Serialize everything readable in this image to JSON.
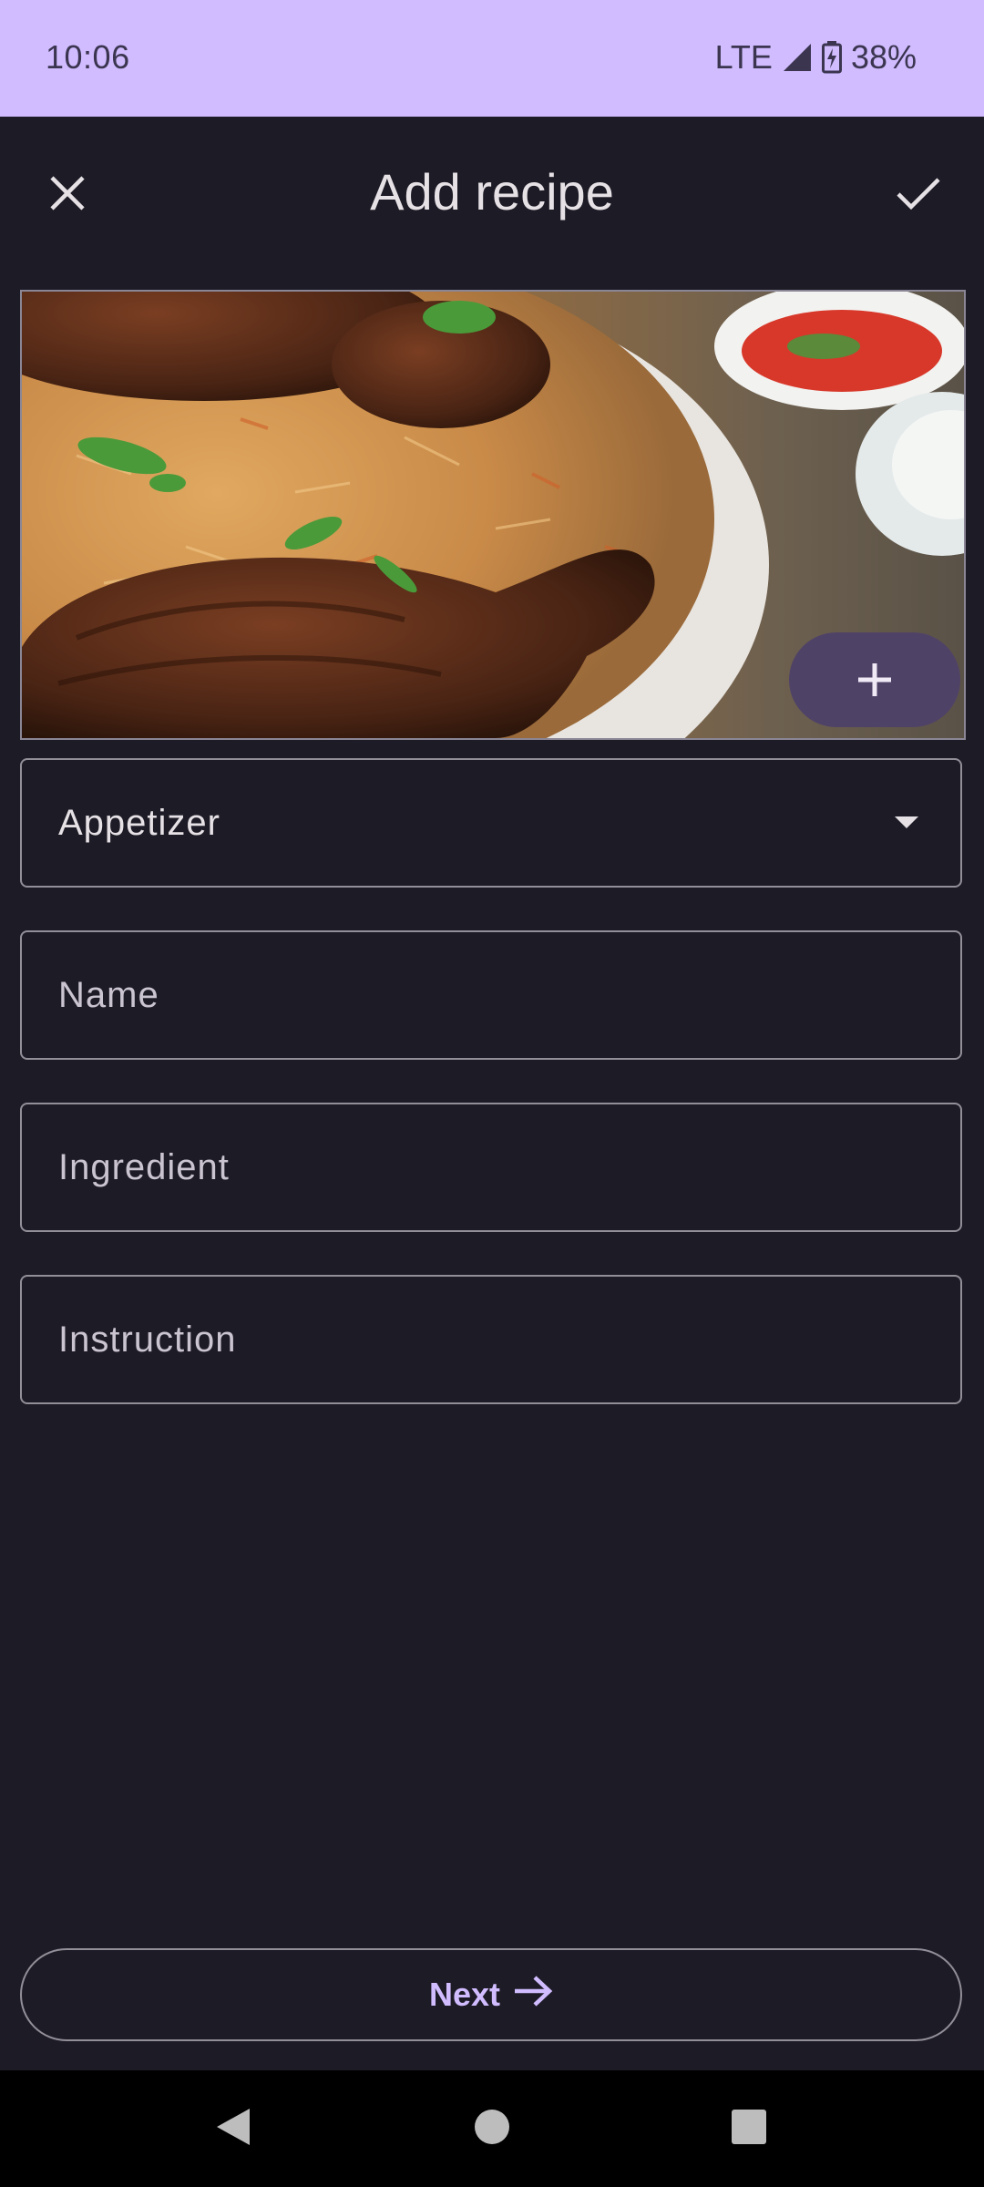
{
  "status_bar": {
    "time": "10:06",
    "network": "LTE",
    "battery": "38%"
  },
  "app_bar": {
    "title": "Add recipe",
    "close_icon": "close-icon",
    "confirm_icon": "check-icon"
  },
  "photo": {
    "add_icon": "plus-icon"
  },
  "form": {
    "category_value": "Appetizer",
    "name_placeholder": "Name",
    "ingredient_placeholder": "Ingredient",
    "instruction_placeholder": "Instruction"
  },
  "next_button": {
    "label": "Next",
    "icon": "arrow-right-icon"
  },
  "colors": {
    "background": "#1d1b26",
    "status_bar": "#d0bcff",
    "accent": "#d0bcff",
    "fab": "#4f4267"
  }
}
